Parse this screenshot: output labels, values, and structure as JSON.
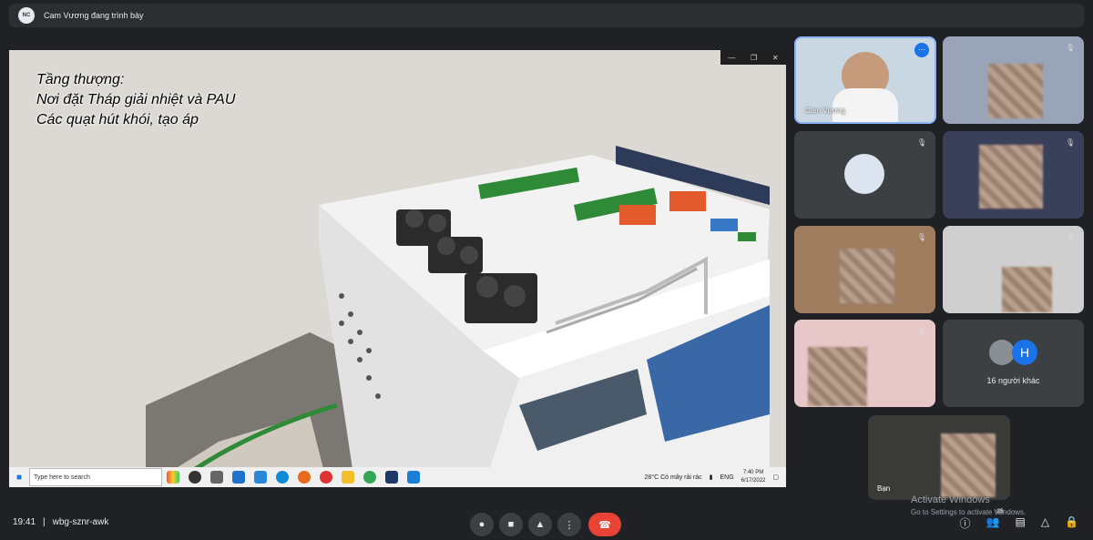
{
  "topbar": {
    "avatar_text": "NC",
    "presenting_label": "Cam Vương đang trình bày"
  },
  "slide": {
    "line1": "Tầng thượng:",
    "line2": "Nơi đặt Tháp giải nhiệt và PAU",
    "line3": "Các quạt hút khói, tạo áp"
  },
  "window_controls": {
    "minimize": "—",
    "restore": "❐",
    "close": "✕"
  },
  "taskbar": {
    "search_placeholder": "Type here to search",
    "weather": "28°C  Có mây rải rác",
    "lang": "ENG",
    "time": "7:40 PM",
    "date": "6/17/2022"
  },
  "participants": [
    {
      "name": "Cam Vương",
      "muted": false
    },
    {
      "name": "",
      "muted": true
    },
    {
      "name": "",
      "muted": true
    },
    {
      "name": "",
      "muted": true
    },
    {
      "name": "",
      "muted": true
    },
    {
      "name": "",
      "muted": true
    },
    {
      "name": "",
      "muted": true
    }
  ],
  "others": {
    "avatar_letter": "H",
    "label": "16 người khác",
    "avatar_color": "#1a73e8"
  },
  "self_tile": {
    "name": "Bạn"
  },
  "bottom": {
    "time": "19:41",
    "separator": "|",
    "meeting_code": "wbg-sznr-awk",
    "people_count": "25"
  },
  "activate_windows": {
    "title": "Activate Windows",
    "subtitle": "Go to Settings to activate Windows."
  },
  "colors": {
    "bg": "#202124",
    "tile": "#3c4043",
    "end_call": "#ea4335",
    "accent": "#1a73e8"
  }
}
